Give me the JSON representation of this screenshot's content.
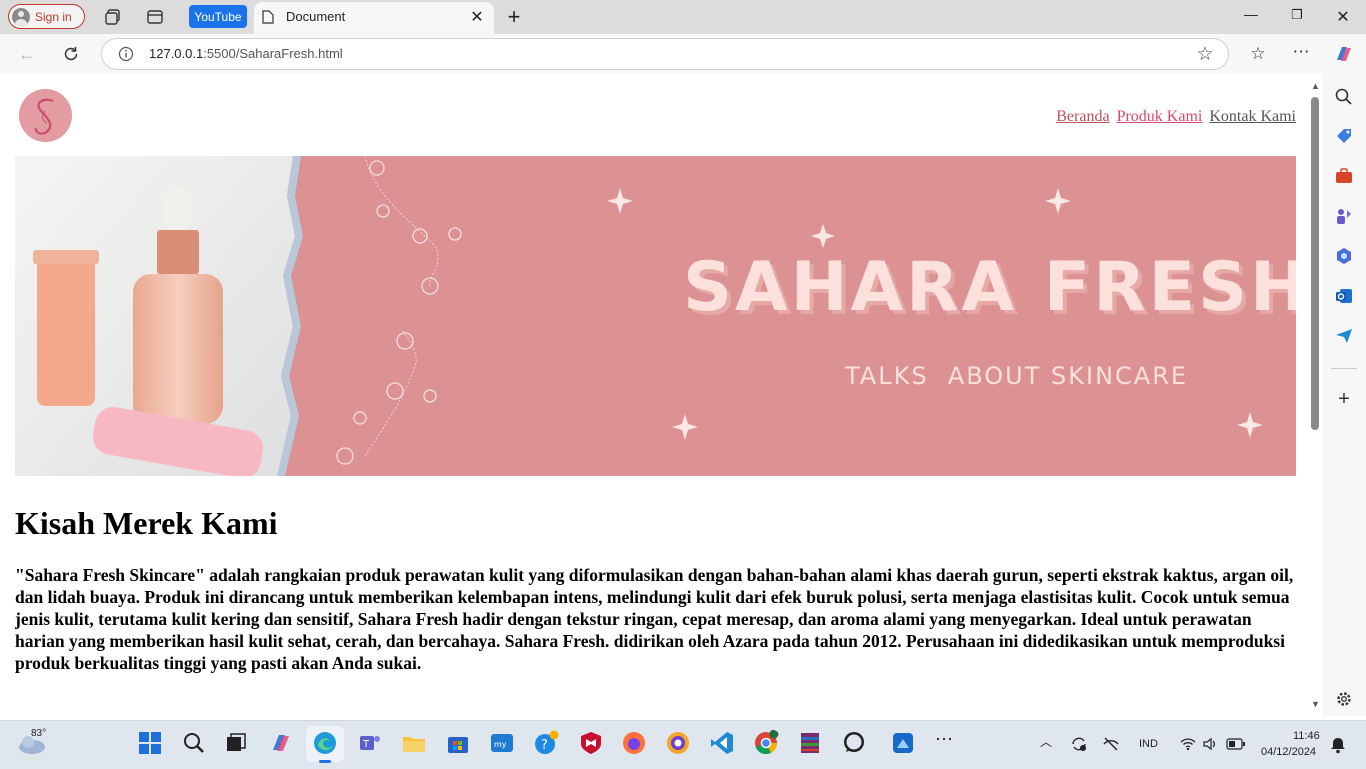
{
  "browser": {
    "signin_label": "Sign in",
    "youtube_label": "YouTube",
    "tab_title": "Document",
    "url_host": "127.0.0.1",
    "url_path": ":5500/SaharaFresh.html"
  },
  "site": {
    "nav": [
      "Beranda",
      "Produk Kami",
      "Kontak Kami"
    ],
    "banner_title": "SAHARA FRESH",
    "banner_tagline": "TALKS  ABOUT SKINCARE",
    "story_heading": "Kisah Merek Kami",
    "story_text": "\"Sahara Fresh Skincare\" adalah rangkaian produk perawatan kulit yang diformulasikan dengan bahan-bahan alami khas daerah gurun, seperti ekstrak kaktus, argan oil, dan lidah buaya. Produk ini dirancang untuk memberikan kelembapan intens, melindungi kulit dari efek buruk polusi, serta menjaga elastisitas kulit. Cocok untuk semua jenis kulit, terutama kulit kering dan sensitif, Sahara Fresh hadir dengan tekstur ringan, cepat meresap, dan aroma alami yang menyegarkan. Ideal untuk perawatan harian yang memberikan hasil kulit sehat, cerah, dan bercahaya. Sahara Fresh. didirikan oleh Azara pada tahun 2012. Perusahaan ini didedikasikan untuk memproduksi produk berkualitas tinggi yang pasti akan Anda sukai."
  },
  "taskbar": {
    "weather": "83°",
    "language": "IND",
    "time": "11:46",
    "date": "04/12/2024"
  },
  "colors": {
    "banner_bg": "#dc9193",
    "banner_text": "#fbe0db",
    "accent": "#1a73e8"
  }
}
